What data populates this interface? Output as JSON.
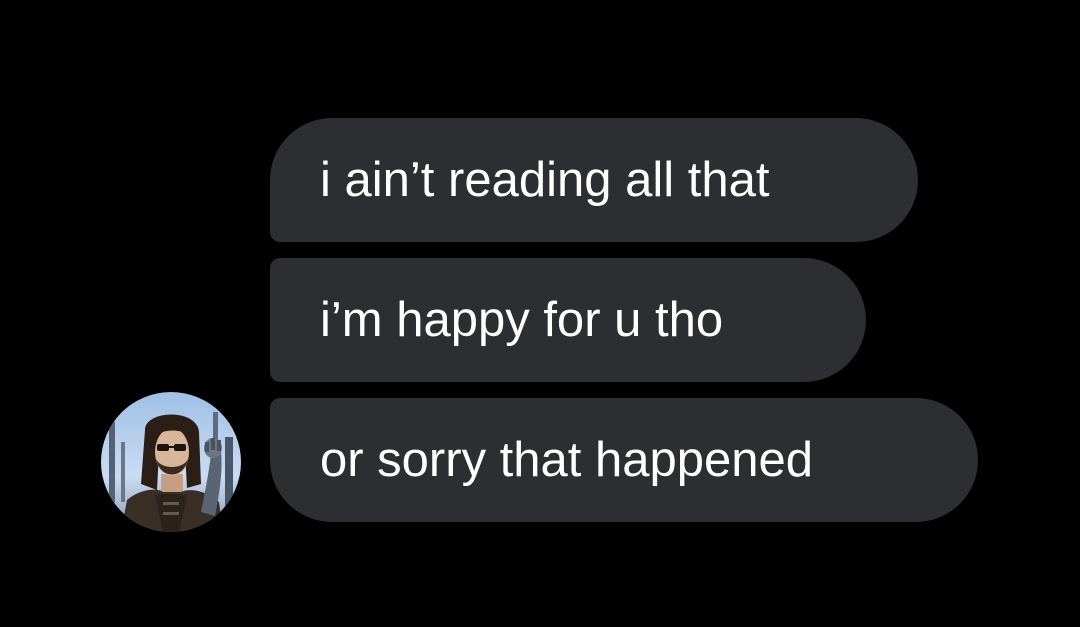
{
  "conversation": {
    "messages": [
      {
        "text": "i ain’t reading all that"
      },
      {
        "text": "i’m happy for u tho"
      },
      {
        "text": "or sorry that happened"
      }
    ],
    "sender_avatar": {
      "icon": "person-avatar",
      "colors": {
        "sky": "#b9d3ee",
        "skin": "#d9b59a",
        "hair": "#2a1e17",
        "vest": "#3a2f27"
      }
    },
    "colors": {
      "background": "#000000",
      "bubble": "#2c2e31",
      "text": "#ffffff"
    }
  }
}
